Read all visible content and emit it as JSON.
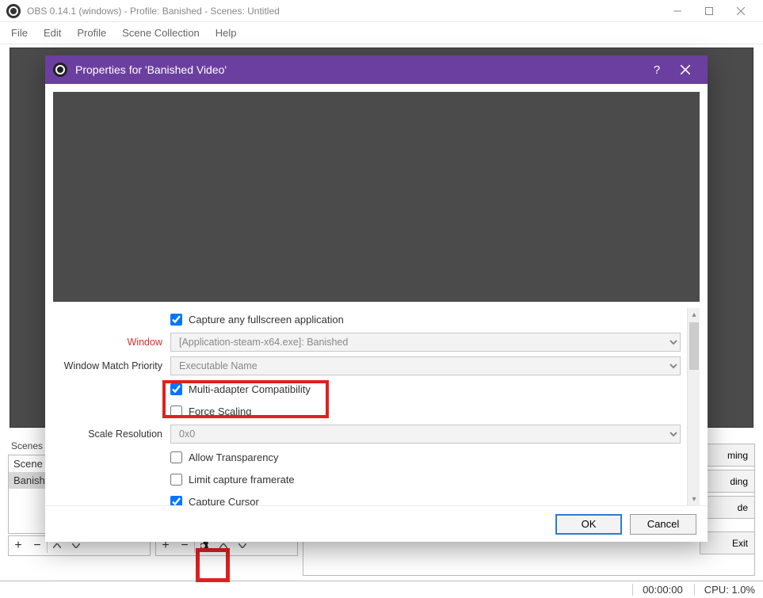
{
  "window": {
    "title": "OBS 0.14.1 (windows) - Profile: Banished - Scenes: Untitled"
  },
  "menubar": [
    "File",
    "Edit",
    "Profile",
    "Scene Collection",
    "Help"
  ],
  "panels": {
    "scenes_label": "Scenes",
    "scenes": [
      {
        "label": "Scene",
        "selected": false
      },
      {
        "label": "Banished",
        "selected": true
      }
    ]
  },
  "right_buttons": [
    "ming",
    "ding",
    "de",
    "Exit"
  ],
  "statusbar": {
    "time": "00:00:00",
    "cpu": "CPU: 1.0%"
  },
  "dialog": {
    "title": "Properties for 'Banished Video'",
    "labels": {
      "window": "Window",
      "priority": "Window Match Priority",
      "scale_res": "Scale Resolution"
    },
    "checkboxes": {
      "capture_fullscreen": {
        "label": "Capture any fullscreen application",
        "checked": true
      },
      "multi_adapter": {
        "label": "Multi-adapter Compatibility",
        "checked": true
      },
      "force_scaling": {
        "label": "Force Scaling",
        "checked": false
      },
      "allow_transparency": {
        "label": "Allow Transparency",
        "checked": false
      },
      "limit_framerate": {
        "label": "Limit capture framerate",
        "checked": false
      },
      "capture_cursor": {
        "label": "Capture Cursor",
        "checked": true
      }
    },
    "selects": {
      "window": "[Application-steam-x64.exe]: Banished",
      "priority": "Executable Name",
      "scale_res": "0x0"
    },
    "buttons": {
      "ok": "OK",
      "cancel": "Cancel"
    }
  }
}
